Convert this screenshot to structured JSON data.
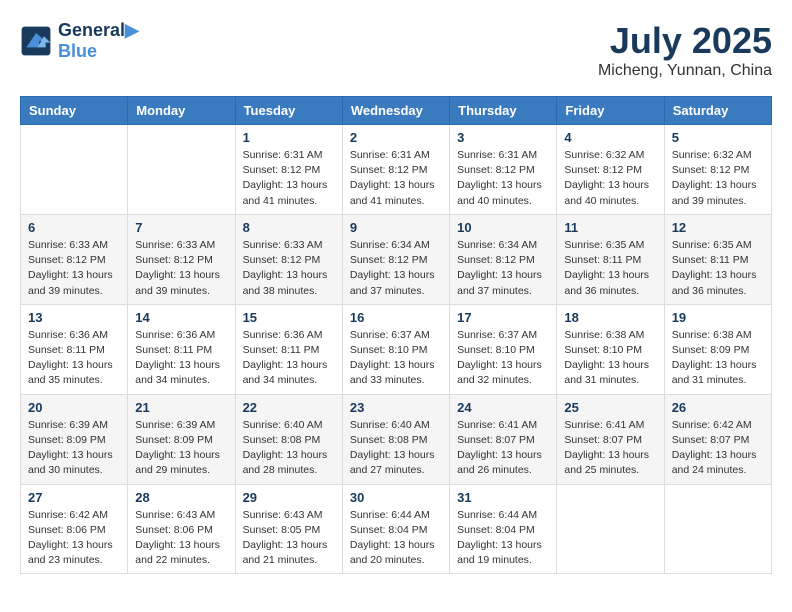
{
  "header": {
    "logo_line1": "General",
    "logo_line2": "Blue",
    "month_year": "July 2025",
    "location": "Micheng, Yunnan, China"
  },
  "weekdays": [
    "Sunday",
    "Monday",
    "Tuesday",
    "Wednesday",
    "Thursday",
    "Friday",
    "Saturday"
  ],
  "weeks": [
    [
      {
        "day": "",
        "info": ""
      },
      {
        "day": "",
        "info": ""
      },
      {
        "day": "1",
        "info": "Sunrise: 6:31 AM\nSunset: 8:12 PM\nDaylight: 13 hours and 41 minutes."
      },
      {
        "day": "2",
        "info": "Sunrise: 6:31 AM\nSunset: 8:12 PM\nDaylight: 13 hours and 41 minutes."
      },
      {
        "day": "3",
        "info": "Sunrise: 6:31 AM\nSunset: 8:12 PM\nDaylight: 13 hours and 40 minutes."
      },
      {
        "day": "4",
        "info": "Sunrise: 6:32 AM\nSunset: 8:12 PM\nDaylight: 13 hours and 40 minutes."
      },
      {
        "day": "5",
        "info": "Sunrise: 6:32 AM\nSunset: 8:12 PM\nDaylight: 13 hours and 39 minutes."
      }
    ],
    [
      {
        "day": "6",
        "info": "Sunrise: 6:33 AM\nSunset: 8:12 PM\nDaylight: 13 hours and 39 minutes."
      },
      {
        "day": "7",
        "info": "Sunrise: 6:33 AM\nSunset: 8:12 PM\nDaylight: 13 hours and 39 minutes."
      },
      {
        "day": "8",
        "info": "Sunrise: 6:33 AM\nSunset: 8:12 PM\nDaylight: 13 hours and 38 minutes."
      },
      {
        "day": "9",
        "info": "Sunrise: 6:34 AM\nSunset: 8:12 PM\nDaylight: 13 hours and 37 minutes."
      },
      {
        "day": "10",
        "info": "Sunrise: 6:34 AM\nSunset: 8:12 PM\nDaylight: 13 hours and 37 minutes."
      },
      {
        "day": "11",
        "info": "Sunrise: 6:35 AM\nSunset: 8:11 PM\nDaylight: 13 hours and 36 minutes."
      },
      {
        "day": "12",
        "info": "Sunrise: 6:35 AM\nSunset: 8:11 PM\nDaylight: 13 hours and 36 minutes."
      }
    ],
    [
      {
        "day": "13",
        "info": "Sunrise: 6:36 AM\nSunset: 8:11 PM\nDaylight: 13 hours and 35 minutes."
      },
      {
        "day": "14",
        "info": "Sunrise: 6:36 AM\nSunset: 8:11 PM\nDaylight: 13 hours and 34 minutes."
      },
      {
        "day": "15",
        "info": "Sunrise: 6:36 AM\nSunset: 8:11 PM\nDaylight: 13 hours and 34 minutes."
      },
      {
        "day": "16",
        "info": "Sunrise: 6:37 AM\nSunset: 8:10 PM\nDaylight: 13 hours and 33 minutes."
      },
      {
        "day": "17",
        "info": "Sunrise: 6:37 AM\nSunset: 8:10 PM\nDaylight: 13 hours and 32 minutes."
      },
      {
        "day": "18",
        "info": "Sunrise: 6:38 AM\nSunset: 8:10 PM\nDaylight: 13 hours and 31 minutes."
      },
      {
        "day": "19",
        "info": "Sunrise: 6:38 AM\nSunset: 8:09 PM\nDaylight: 13 hours and 31 minutes."
      }
    ],
    [
      {
        "day": "20",
        "info": "Sunrise: 6:39 AM\nSunset: 8:09 PM\nDaylight: 13 hours and 30 minutes."
      },
      {
        "day": "21",
        "info": "Sunrise: 6:39 AM\nSunset: 8:09 PM\nDaylight: 13 hours and 29 minutes."
      },
      {
        "day": "22",
        "info": "Sunrise: 6:40 AM\nSunset: 8:08 PM\nDaylight: 13 hours and 28 minutes."
      },
      {
        "day": "23",
        "info": "Sunrise: 6:40 AM\nSunset: 8:08 PM\nDaylight: 13 hours and 27 minutes."
      },
      {
        "day": "24",
        "info": "Sunrise: 6:41 AM\nSunset: 8:07 PM\nDaylight: 13 hours and 26 minutes."
      },
      {
        "day": "25",
        "info": "Sunrise: 6:41 AM\nSunset: 8:07 PM\nDaylight: 13 hours and 25 minutes."
      },
      {
        "day": "26",
        "info": "Sunrise: 6:42 AM\nSunset: 8:07 PM\nDaylight: 13 hours and 24 minutes."
      }
    ],
    [
      {
        "day": "27",
        "info": "Sunrise: 6:42 AM\nSunset: 8:06 PM\nDaylight: 13 hours and 23 minutes."
      },
      {
        "day": "28",
        "info": "Sunrise: 6:43 AM\nSunset: 8:06 PM\nDaylight: 13 hours and 22 minutes."
      },
      {
        "day": "29",
        "info": "Sunrise: 6:43 AM\nSunset: 8:05 PM\nDaylight: 13 hours and 21 minutes."
      },
      {
        "day": "30",
        "info": "Sunrise: 6:44 AM\nSunset: 8:04 PM\nDaylight: 13 hours and 20 minutes."
      },
      {
        "day": "31",
        "info": "Sunrise: 6:44 AM\nSunset: 8:04 PM\nDaylight: 13 hours and 19 minutes."
      },
      {
        "day": "",
        "info": ""
      },
      {
        "day": "",
        "info": ""
      }
    ]
  ]
}
